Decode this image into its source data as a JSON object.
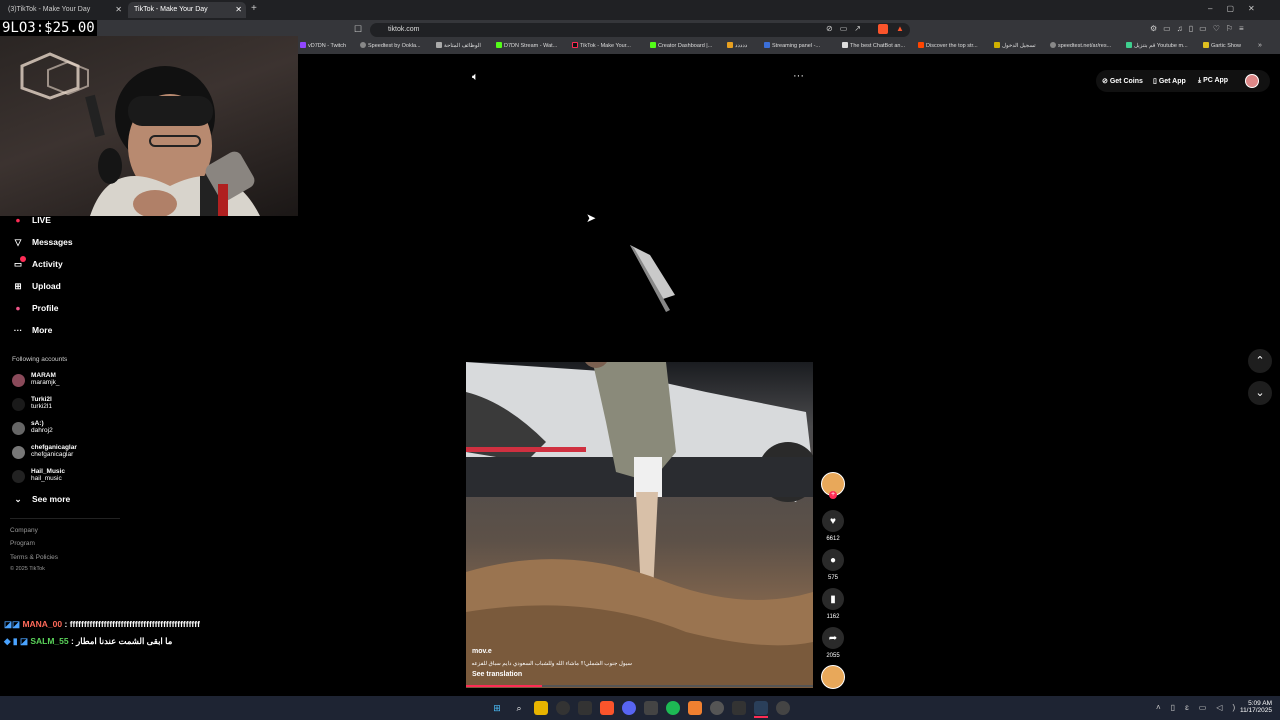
{
  "browser": {
    "tabs": [
      {
        "title": "(3)TikTok - Make Your Day"
      },
      {
        "title": "TikTok - Make Your Day"
      }
    ],
    "new_tab": "+",
    "url": "tiktok.com",
    "bookmarks": [
      "vD7DN - Twitch",
      "Speedtest by Ookla...",
      "الوظائف المتاحة",
      "D7DN Stream - Wat...",
      "TikTok - Make Your...",
      "Creator Dashboard |...",
      "ددددد",
      "Streaming panel -...",
      "The best ChatBot an...",
      "Discover the top str...",
      "تسجيل الدخول",
      "speedtest.net/ar/res...",
      "قم بتنزيل Youtube m...",
      "Gartic Show"
    ]
  },
  "overlay": {
    "money": "9LO3:$25.00"
  },
  "sidebar": {
    "nav": [
      {
        "label": "LIVE",
        "icon": "live-icon"
      },
      {
        "label": "Messages",
        "icon": "messages-icon"
      },
      {
        "label": "Activity",
        "icon": "activity-icon"
      },
      {
        "label": "Upload",
        "icon": "upload-icon"
      },
      {
        "label": "Profile",
        "icon": "profile-icon"
      },
      {
        "label": "More",
        "icon": "more-icon"
      }
    ],
    "following_title": "Following accounts",
    "accounts": [
      {
        "name": "MARAM",
        "handle": "maramjk_"
      },
      {
        "name": "Turki2l",
        "handle": "turki2l1"
      },
      {
        "name": "sA:)",
        "handle": "dahroj2"
      },
      {
        "name": "chefganicaglar",
        "handle": "chefganicaglar"
      },
      {
        "name": "Hail_Music",
        "handle": "hail_music"
      }
    ],
    "see_more": "See more",
    "footer": [
      "Company",
      "Program",
      "Terms & Policies",
      "© 2025 TikTok"
    ]
  },
  "header_right": {
    "get_coins": "Get Coins",
    "get_app": "Get App",
    "pc_app": "PC App"
  },
  "video": {
    "author": "mov.e",
    "caption": "سيول جنوب الشملي!!! ماشاء الله وللشباب السعودي دايم سباق للفزعه",
    "see_translation": "See translation",
    "progress": 0.22
  },
  "actions": {
    "likes": "6612",
    "comments": "575",
    "saves": "1162",
    "shares": "2055"
  },
  "chat": [
    {
      "user": "MANA_00",
      "text": "ffffffffffffffffffffffffffffffffffffffffffffff"
    },
    {
      "user": "SALM_55",
      "text": "ما ابقى الشمت عندنا امطار"
    }
  ],
  "taskbar": {
    "time": "5:09 AM",
    "date": "11/17/2025"
  },
  "colors": {
    "tiktok_red": "#fe2c55",
    "chat_user1": "#ff6a5a",
    "chat_user2": "#5ad35a"
  }
}
